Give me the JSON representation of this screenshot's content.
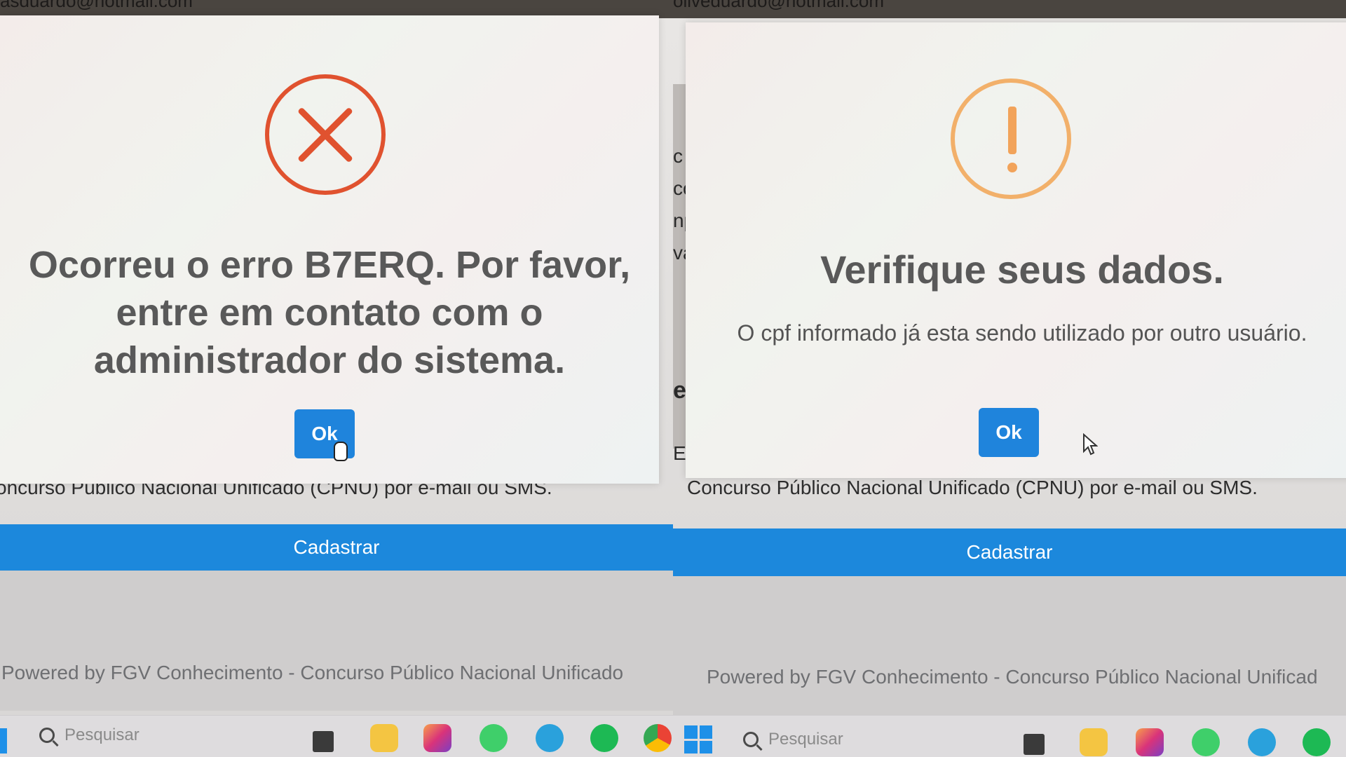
{
  "left_panel": {
    "email_partial": "asduardo@hotmail.com",
    "dialog": {
      "icon": "error-x-icon",
      "title": "Ocorreu o erro B7ERQ. Por favor, entre em contato com o administrador do sistema.",
      "ok_label": "Ok"
    },
    "description": "oncurso Público Nacional Unificado (CPNU) por e-mail ou SMS.",
    "submit_label": "Cadastrar",
    "footer": "Powered by FGV Conhecimento - Concurso Público Nacional Unificado",
    "taskbar": {
      "search_placeholder": "Pesquisar"
    }
  },
  "right_panel": {
    "email_partial": "oliveduardo@hotmail.com",
    "side_letters": [
      "c",
      "co",
      "np",
      "va",
      "er",
      "E"
    ],
    "dialog": {
      "icon": "warning-exclamation-icon",
      "title": "Verifique seus dados.",
      "message": "O cpf informado já esta sendo utilizado por outro usuário.",
      "ok_label": "Ok"
    },
    "description": "Concurso Público Nacional Unificado (CPNU) por e-mail ou SMS.",
    "submit_label": "Cadastrar",
    "footer": "Powered by FGV Conhecimento - Concurso Público Nacional Unificad",
    "taskbar": {
      "search_placeholder": "Pesquisar"
    }
  },
  "colors": {
    "primary_blue": "#1f84dc",
    "error_red": "#e0522f",
    "warning_orange": "#f2b06a",
    "dialog_text": "#595959"
  }
}
